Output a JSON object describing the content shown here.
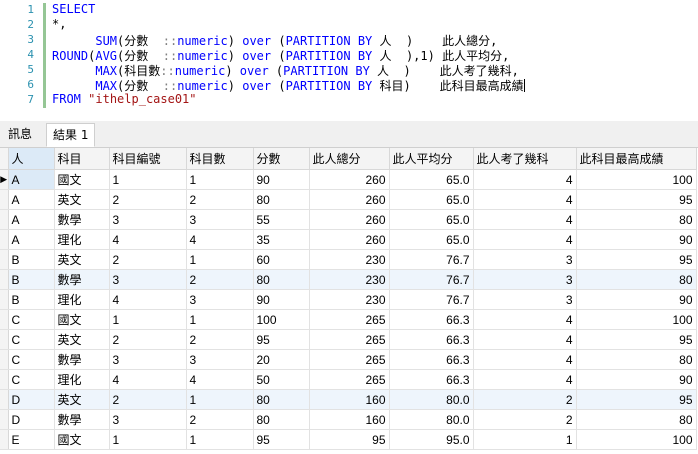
{
  "editor": {
    "line_numbers": [
      "1",
      "2",
      "3",
      "4",
      "5",
      "6",
      "7"
    ],
    "lines": [
      [
        {
          "t": "SELECT",
          "c": "kw"
        }
      ],
      [
        {
          "t": "*,",
          "c": ""
        }
      ],
      [
        {
          "t": "      ",
          "c": ""
        },
        {
          "t": "SUM",
          "c": "kw"
        },
        {
          "t": "(分數  ",
          "c": ""
        },
        {
          "t": "::",
          "c": "op"
        },
        {
          "t": "numeric",
          "c": "kw"
        },
        {
          "t": ") ",
          "c": ""
        },
        {
          "t": "over",
          "c": "kw"
        },
        {
          "t": " (",
          "c": ""
        },
        {
          "t": "PARTITION BY",
          "c": "kw"
        },
        {
          "t": " 人  )    此人總分,",
          "c": ""
        }
      ],
      [
        {
          "t": "ROUND",
          "c": "kw"
        },
        {
          "t": "(",
          "c": ""
        },
        {
          "t": "AVG",
          "c": "kw"
        },
        {
          "t": "(分數  ",
          "c": ""
        },
        {
          "t": "::",
          "c": "op"
        },
        {
          "t": "numeric",
          "c": "kw"
        },
        {
          "t": ") ",
          "c": ""
        },
        {
          "t": "over",
          "c": "kw"
        },
        {
          "t": " (",
          "c": ""
        },
        {
          "t": "PARTITION BY",
          "c": "kw"
        },
        {
          "t": " 人  ),",
          "c": ""
        },
        {
          "t": "1",
          "c": "num"
        },
        {
          "t": ") 此人平均分,",
          "c": ""
        }
      ],
      [
        {
          "t": "      ",
          "c": ""
        },
        {
          "t": "MAX",
          "c": "kw"
        },
        {
          "t": "(科目數",
          "c": ""
        },
        {
          "t": "::",
          "c": "op"
        },
        {
          "t": "numeric",
          "c": "kw"
        },
        {
          "t": ") ",
          "c": ""
        },
        {
          "t": "over",
          "c": "kw"
        },
        {
          "t": " (",
          "c": ""
        },
        {
          "t": "PARTITION BY",
          "c": "kw"
        },
        {
          "t": " 人  )    此人考了幾科,",
          "c": ""
        }
      ],
      [
        {
          "t": "      ",
          "c": ""
        },
        {
          "t": "MAX",
          "c": "kw"
        },
        {
          "t": "(分數  ",
          "c": ""
        },
        {
          "t": "::",
          "c": "op"
        },
        {
          "t": "numeric",
          "c": "kw"
        },
        {
          "t": ") ",
          "c": ""
        },
        {
          "t": "over",
          "c": "kw"
        },
        {
          "t": " (",
          "c": ""
        },
        {
          "t": "PARTITION BY",
          "c": "kw"
        },
        {
          "t": " 科目)    此科目最高成績",
          "c": ""
        }
      ],
      [
        {
          "t": "FROM",
          "c": "kw"
        },
        {
          "t": " ",
          "c": ""
        },
        {
          "t": "\"ithelp_case01\"",
          "c": "str"
        }
      ]
    ]
  },
  "tabs": [
    {
      "label": "訊息",
      "active": false
    },
    {
      "label": "結果 1",
      "active": true
    }
  ],
  "grid": {
    "columns": [
      "人",
      "科目",
      "科目編號",
      "科目數",
      "分數",
      "此人總分",
      "此人平均分",
      "此人考了幾科",
      "此科目最高成績"
    ],
    "align": [
      "l",
      "l",
      "l",
      "l",
      "l",
      "r",
      "r",
      "r",
      "r"
    ],
    "rows": [
      [
        "A",
        "國文",
        "1",
        "1",
        "90",
        "260",
        "65.0",
        "4",
        "100"
      ],
      [
        "A",
        "英文",
        "2",
        "2",
        "80",
        "260",
        "65.0",
        "4",
        "95"
      ],
      [
        "A",
        "數學",
        "3",
        "3",
        "55",
        "260",
        "65.0",
        "4",
        "80"
      ],
      [
        "A",
        "理化",
        "4",
        "4",
        "35",
        "260",
        "65.0",
        "4",
        "90"
      ],
      [
        "B",
        "英文",
        "2",
        "1",
        "60",
        "230",
        "76.7",
        "3",
        "95"
      ],
      [
        "B",
        "數學",
        "3",
        "2",
        "80",
        "230",
        "76.7",
        "3",
        "80"
      ],
      [
        "B",
        "理化",
        "4",
        "3",
        "90",
        "230",
        "76.7",
        "3",
        "90"
      ],
      [
        "C",
        "國文",
        "1",
        "1",
        "100",
        "265",
        "66.3",
        "4",
        "100"
      ],
      [
        "C",
        "英文",
        "2",
        "2",
        "95",
        "265",
        "66.3",
        "4",
        "95"
      ],
      [
        "C",
        "數學",
        "3",
        "3",
        "20",
        "265",
        "66.3",
        "4",
        "80"
      ],
      [
        "C",
        "理化",
        "4",
        "4",
        "50",
        "265",
        "66.3",
        "4",
        "90"
      ],
      [
        "D",
        "英文",
        "2",
        "1",
        "80",
        "160",
        "80.0",
        "2",
        "95"
      ],
      [
        "D",
        "數學",
        "3",
        "2",
        "80",
        "160",
        "80.0",
        "2",
        "80"
      ],
      [
        "E",
        "國文",
        "1",
        "1",
        "95",
        "95",
        "95.0",
        "1",
        "100"
      ]
    ],
    "current_row_marker": "▶"
  }
}
